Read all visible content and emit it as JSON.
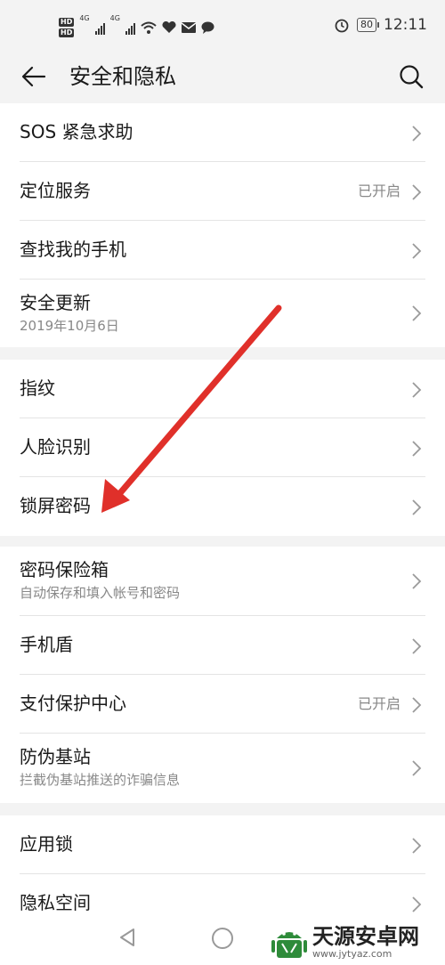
{
  "status_bar": {
    "hd_labels": [
      "HD",
      "HD"
    ],
    "network_4g_a": "4G",
    "network_4g_b": "4G",
    "battery": "80",
    "time": "12:11"
  },
  "header": {
    "title": "安全和隐私"
  },
  "groups": [
    {
      "items": [
        {
          "label": "SOS 紧急求助"
        },
        {
          "label": "定位服务",
          "value": "已开启"
        },
        {
          "label": "查找我的手机"
        },
        {
          "label": "安全更新",
          "sub": "2019年10月6日"
        }
      ]
    },
    {
      "items": [
        {
          "label": "指纹"
        },
        {
          "label": "人脸识别"
        },
        {
          "label": "锁屏密码"
        }
      ]
    },
    {
      "items": [
        {
          "label": "密码保险箱",
          "sub": "自动保存和填入帐号和密码"
        },
        {
          "label": "手机盾"
        },
        {
          "label": "支付保护中心",
          "value": "已开启"
        },
        {
          "label": "防伪基站",
          "sub": "拦截伪基站推送的诈骗信息"
        }
      ]
    },
    {
      "items": [
        {
          "label": "应用锁"
        },
        {
          "label": "隐私空间"
        }
      ]
    }
  ],
  "watermark": {
    "name": "天源安卓网",
    "url": "www.jytyaz.com"
  },
  "colors": {
    "arrow": "#e0302a",
    "background": "#f3f3f3",
    "row": "#ffffff"
  }
}
